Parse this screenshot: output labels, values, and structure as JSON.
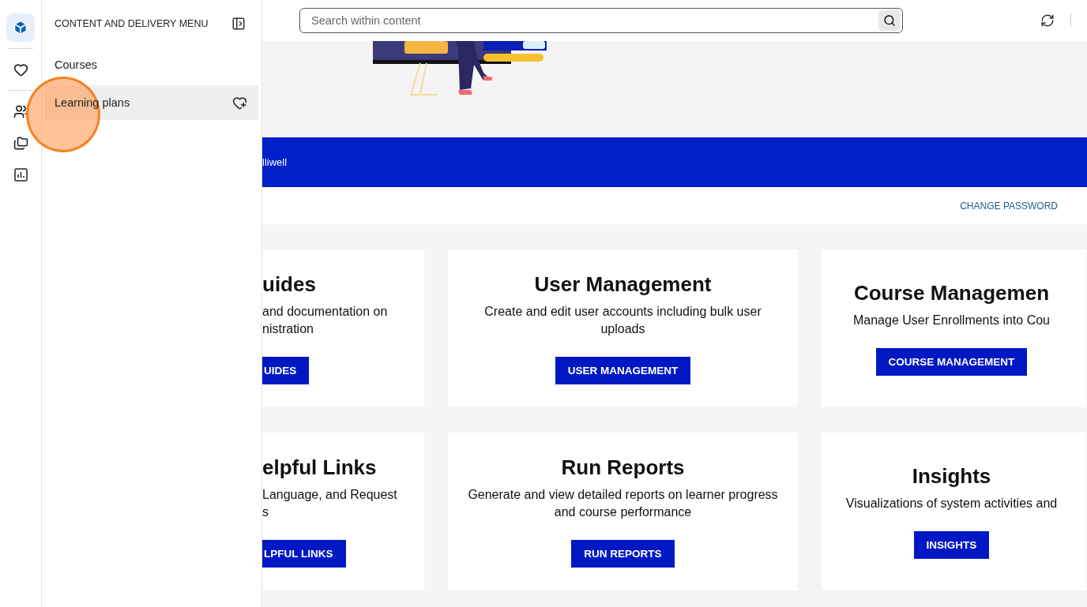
{
  "rail_groups": [
    [
      {
        "kind": "cube",
        "selected": true
      }
    ],
    [
      {
        "kind": "heart",
        "selected": false
      }
    ],
    [
      {
        "kind": "users",
        "selected": false
      },
      {
        "kind": "folders",
        "selected": false
      },
      {
        "kind": "chart",
        "selected": false
      }
    ]
  ],
  "click_marker": true,
  "drawer": {
    "title": "CONTENT AND DELIVERY MENU",
    "items": [
      {
        "label": "Courses",
        "selected": false,
        "favorite_action": false
      },
      {
        "label": "Learning plans",
        "selected": true,
        "favorite_action": true
      }
    ]
  },
  "search": {
    "placeholder": "Search within content"
  },
  "banner": {
    "text": "lliwell"
  },
  "change_password": "CHANGE PASSWORD",
  "cards": [
    {
      "kind": "cut_left",
      "title": "uides",
      "description": "and documentation on\nnistration",
      "button": "UIDES"
    },
    {
      "kind": "full",
      "title": "User Management",
      "description": "Create and edit user accounts including bulk user uploads",
      "button": "USER MANAGEMENT"
    },
    {
      "kind": "cut_right",
      "title": "Course Managemen",
      "description": "Manage User Enrollments into Cou",
      "button": "COURSE MANAGEMENT"
    },
    {
      "kind": "cut_left",
      "title": "elpful Links",
      "description": "Language, and Request\ns",
      "button": "LPFUL LINKS"
    },
    {
      "kind": "full",
      "title": "Run Reports",
      "description": "Generate and view detailed reports on learner progress and course performance",
      "button": "RUN REPORTS"
    },
    {
      "kind": "cut_right",
      "title": "Insights",
      "description": "Visualizations of system activities and",
      "button": "INSIGHTS"
    }
  ]
}
